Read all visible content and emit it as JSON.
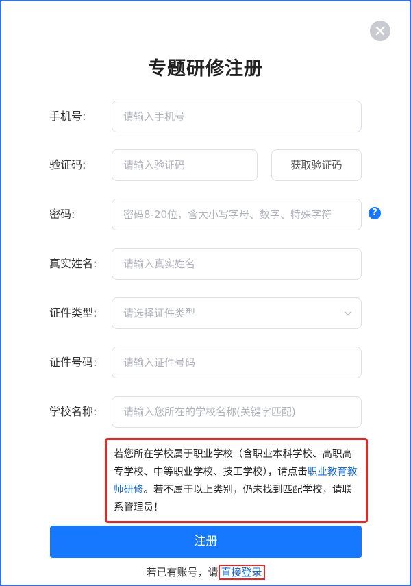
{
  "dialog": {
    "title": "专题研修注册",
    "close_icon": "close-icon"
  },
  "form": {
    "phone": {
      "label": "手机号:",
      "placeholder": "请输入手机号",
      "value": ""
    },
    "code": {
      "label": "验证码:",
      "placeholder": "请输入验证码",
      "value": "",
      "button_label": "获取验证码"
    },
    "password": {
      "label": "密码:",
      "placeholder": "密码8-20位，含大小写字母、数字、特殊字符",
      "value": "",
      "help_icon": "question-icon",
      "help_glyph": "?"
    },
    "real_name": {
      "label": "真实姓名:",
      "placeholder": "请输入真实姓名",
      "value": ""
    },
    "id_type": {
      "label": "证件类型:",
      "placeholder": "请选择证件类型",
      "selected": ""
    },
    "id_number": {
      "label": "证件号码:",
      "placeholder": "请输入证件号码",
      "value": ""
    },
    "school": {
      "label": "学校名称:",
      "placeholder": "请输入您所在的学校名称(关键字匹配)",
      "value": ""
    }
  },
  "notice": {
    "text_before": "若您所在学校属于职业学校（含职业本科学校、高职高专学校、中等职业学校、技工学校），请点击",
    "link": "职业教育教师研修",
    "text_after": "。若不属于以上类别，仍未找到匹配学校，请联系管理员！"
  },
  "actions": {
    "register_label": "注册",
    "login_prompt": "若已有账号，请",
    "login_link": "直接登录"
  },
  "colors": {
    "primary": "#1677ff",
    "highlight_border": "#e02a2a",
    "link": "#1668dc"
  }
}
